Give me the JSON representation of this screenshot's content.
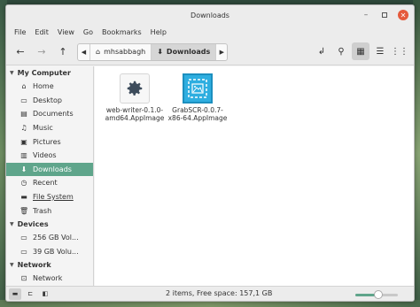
{
  "window": {
    "title": "Downloads"
  },
  "menu": [
    "File",
    "Edit",
    "View",
    "Go",
    "Bookmarks",
    "Help"
  ],
  "breadcrumbs": [
    {
      "label": "mhsabbagh",
      "icon": "home-icon"
    },
    {
      "label": "Downloads",
      "icon": "download-icon",
      "active": true
    }
  ],
  "sidebar": {
    "sections": [
      {
        "title": "My Computer",
        "items": [
          {
            "label": "Home",
            "icon": "home-icon"
          },
          {
            "label": "Desktop",
            "icon": "desktop-icon"
          },
          {
            "label": "Documents",
            "icon": "documents-icon"
          },
          {
            "label": "Music",
            "icon": "music-icon"
          },
          {
            "label": "Pictures",
            "icon": "pictures-icon"
          },
          {
            "label": "Videos",
            "icon": "videos-icon"
          },
          {
            "label": "Downloads",
            "icon": "download-icon",
            "selected": true
          },
          {
            "label": "Recent",
            "icon": "recent-icon"
          },
          {
            "label": "File System",
            "icon": "filesystem-icon"
          },
          {
            "label": "Trash",
            "icon": "trash-icon"
          }
        ]
      },
      {
        "title": "Devices",
        "items": [
          {
            "label": "256 GB Vol...",
            "icon": "drive-icon"
          },
          {
            "label": "39 GB Volu...",
            "icon": "drive-icon"
          }
        ]
      },
      {
        "title": "Network",
        "items": [
          {
            "label": "Network",
            "icon": "network-icon"
          }
        ]
      }
    ]
  },
  "files": [
    {
      "name_line1": "web-writer-0.1.0-",
      "name_line2": "amd64.AppImage",
      "icon": "gear-icon"
    },
    {
      "name_line1": "GrabSCR-0.0.7-",
      "name_line2": "x86-64.AppImage",
      "icon": "screenshot-app-icon"
    }
  ],
  "status": {
    "text": "2 items, Free space: 157,1 GB",
    "zoom_level": 0.55
  },
  "colors": {
    "accent": "#5fa58b",
    "close": "#e55a3c",
    "grab_icon": "#2eaee0"
  }
}
